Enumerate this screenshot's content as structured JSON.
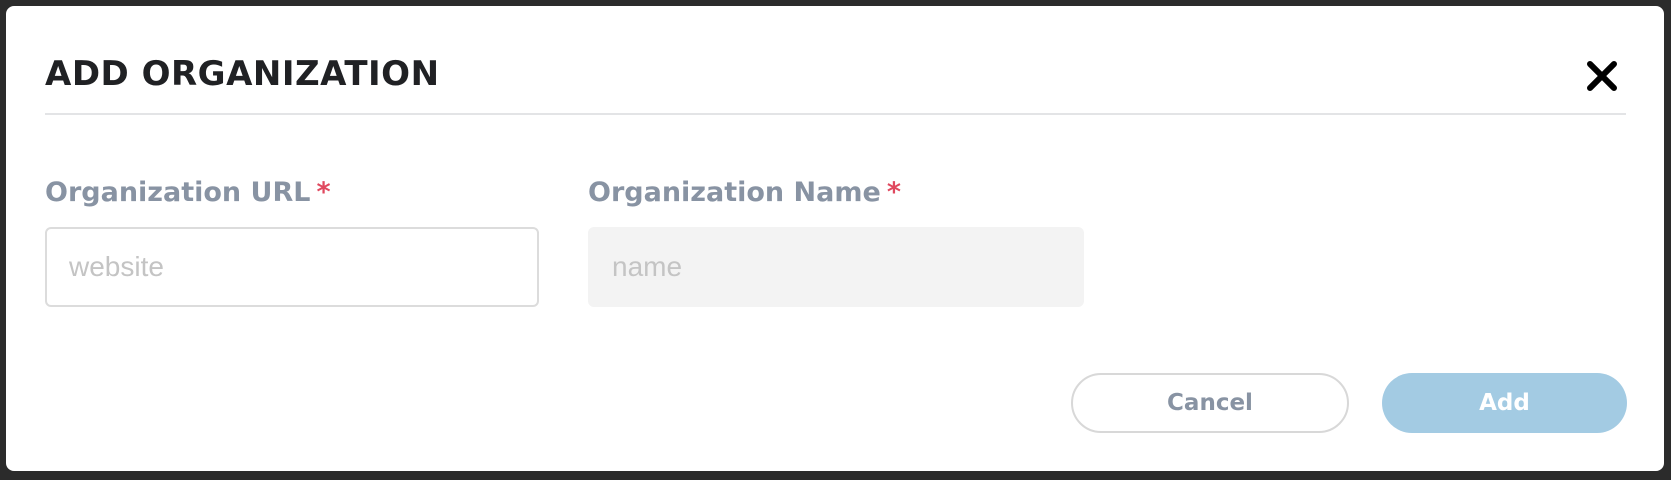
{
  "modal": {
    "title": "ADD ORGANIZATION",
    "close_icon": "close-x-icon"
  },
  "form": {
    "url_field": {
      "label": "Organization URL",
      "required_mark": "*",
      "placeholder": "website",
      "value": ""
    },
    "name_field": {
      "label": "Organization Name",
      "required_mark": "*",
      "placeholder": "name",
      "value": "",
      "disabled": true
    }
  },
  "actions": {
    "cancel_label": "Cancel",
    "add_label": "Add"
  },
  "colors": {
    "title_text": "#202124",
    "label_text": "#8893a3",
    "required_mark": "#e0495f",
    "add_button_bg": "#a3cbe3",
    "disabled_input_bg": "#f3f3f3",
    "backdrop": "#2b2b2b"
  }
}
